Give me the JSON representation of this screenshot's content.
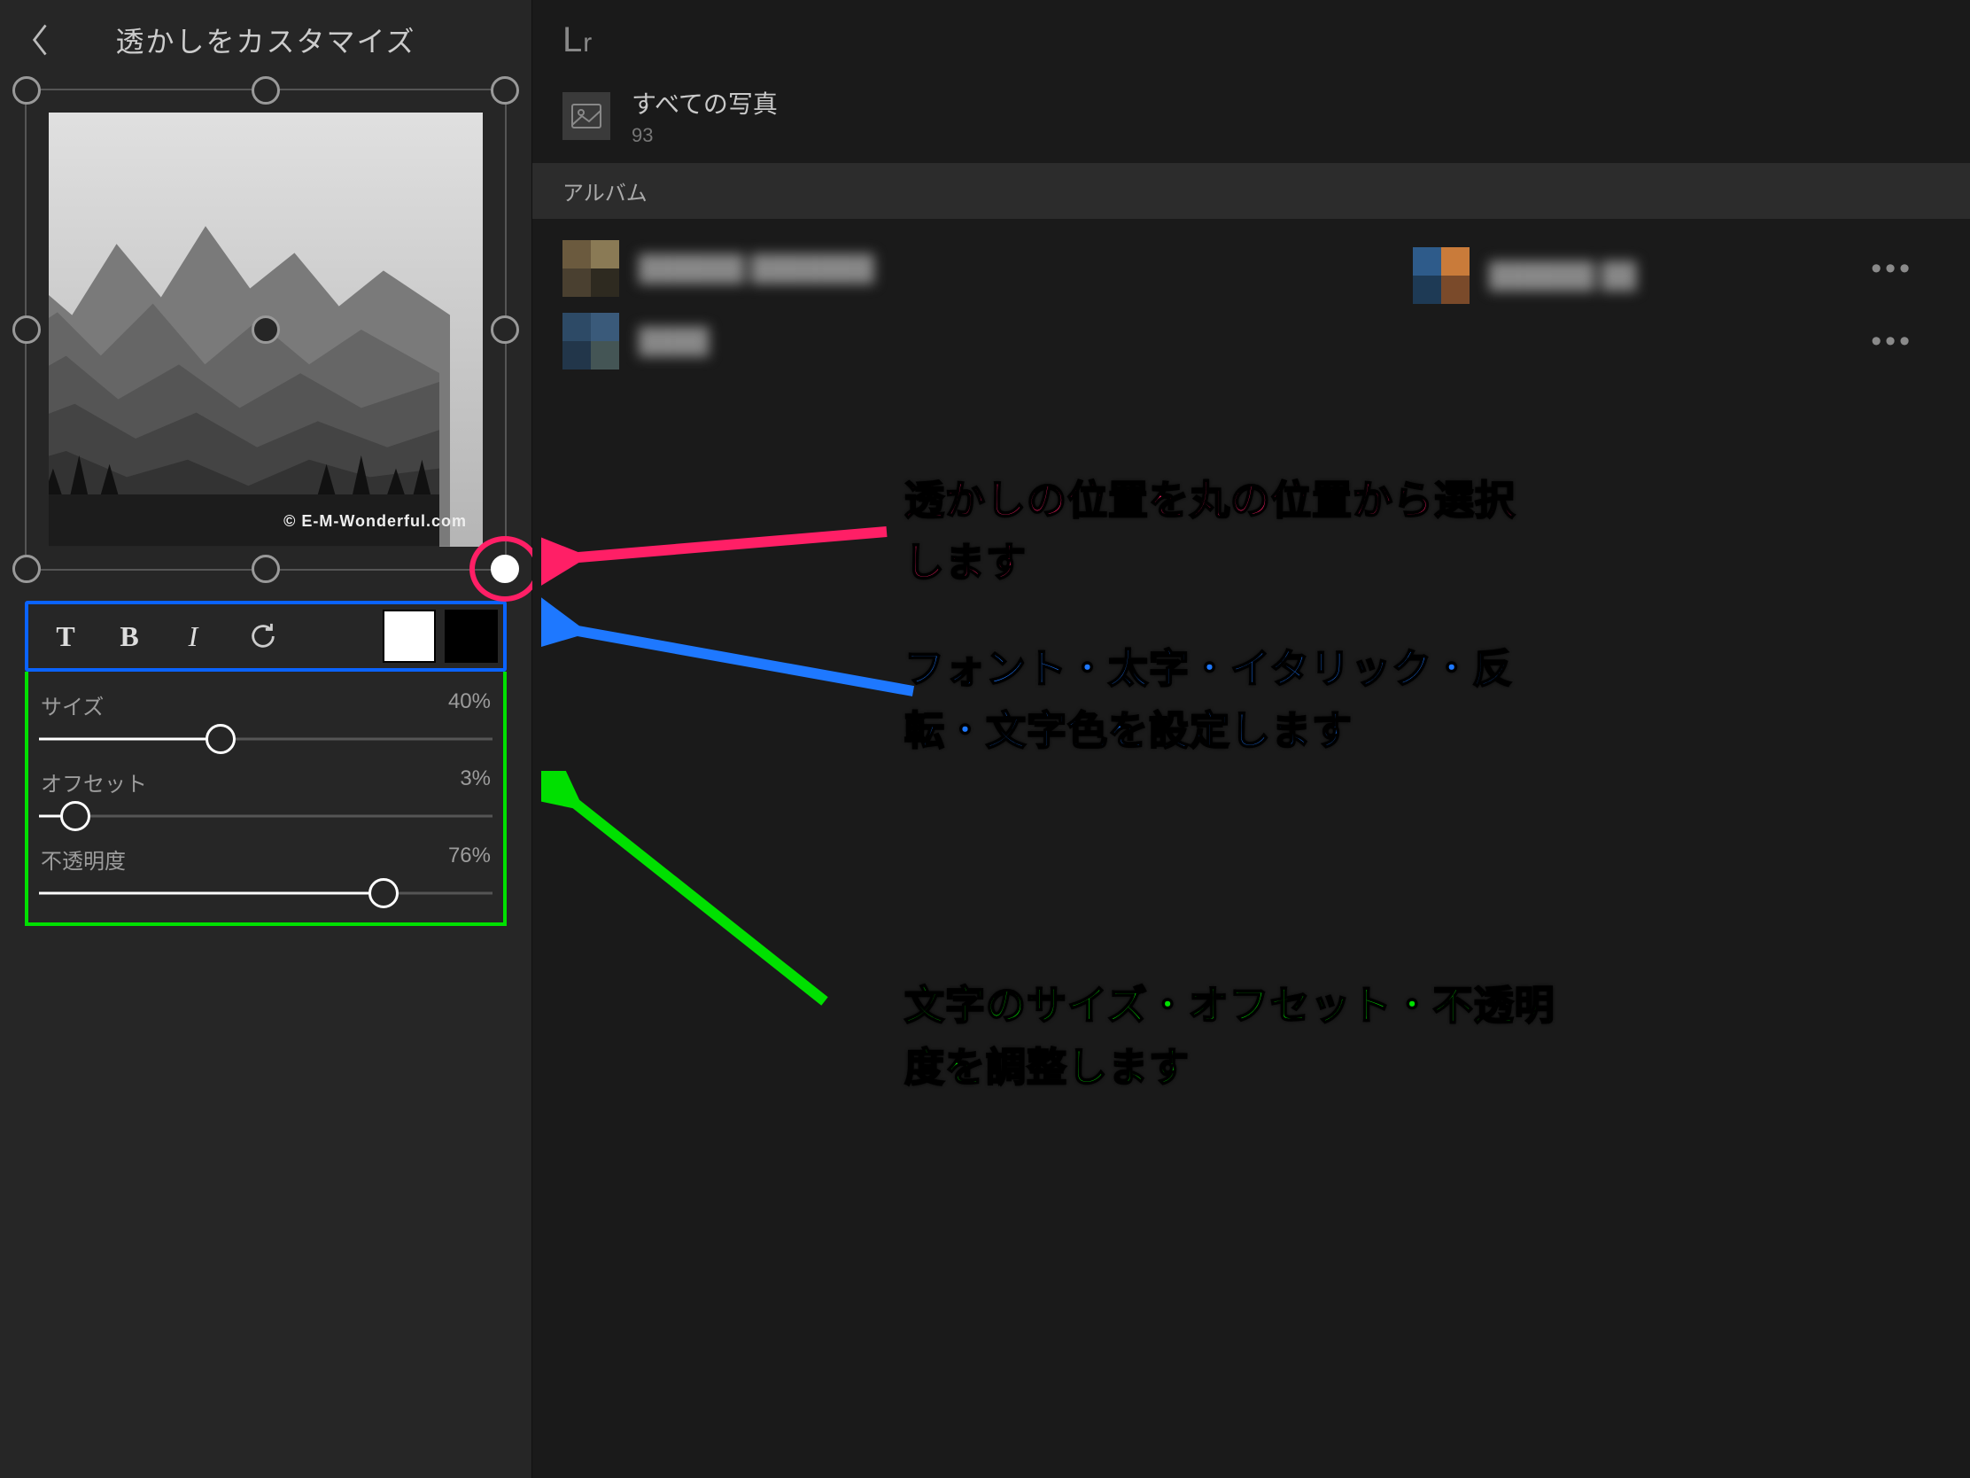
{
  "left": {
    "title": "透かしをカスタマイズ",
    "watermark_sample": "© E-M-Wonderful.com",
    "toolbar": {
      "text_btn": "T",
      "bold_btn": "B",
      "italic_btn": "I"
    },
    "sliders": {
      "size": {
        "label": "サイズ",
        "value_text": "40%",
        "percent": 40
      },
      "offset": {
        "label": "オフセット",
        "value_text": "3%",
        "percent": 8
      },
      "opacity": {
        "label": "不透明度",
        "value_text": "76%",
        "percent": 76
      }
    }
  },
  "right": {
    "logo": "Lr",
    "all_photos_label": "すべての写真",
    "all_photos_count": "93",
    "album_header": "アルバム"
  },
  "annotations": {
    "red": "透かしの位置を丸の位置から選択します",
    "blue": "フォント・太字・イタリック・反転・文字色を設定します",
    "green": "文字のサイズ・オフセット・不透明度を調整します"
  }
}
